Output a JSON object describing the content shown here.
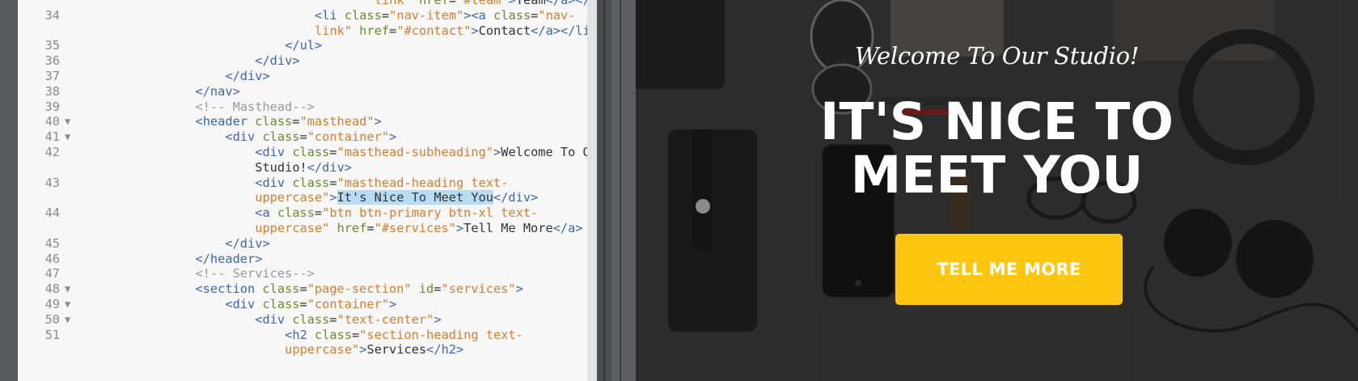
{
  "editor": {
    "lines": [
      {
        "num": "",
        "fold": false,
        "indent": 40,
        "tokens": [
          [
            "str",
            "link\" "
          ],
          [
            "attr",
            "href"
          ],
          [
            "txt",
            "="
          ],
          [
            "str",
            "\"#team\""
          ],
          [
            "tag",
            ">"
          ],
          [
            "txt",
            "Team"
          ],
          [
            "tag",
            "</a></li>"
          ]
        ]
      },
      {
        "num": "34",
        "fold": false,
        "indent": 32,
        "tokens": [
          [
            "tag",
            "<li "
          ],
          [
            "attr",
            "class"
          ],
          [
            "txt",
            "="
          ],
          [
            "str",
            "\"nav-item\""
          ],
          [
            "tag",
            "><a "
          ],
          [
            "attr",
            "class"
          ],
          [
            "txt",
            "="
          ],
          [
            "str",
            "\"nav-"
          ]
        ]
      },
      {
        "num": "",
        "fold": false,
        "indent": 32,
        "tokens": [
          [
            "str",
            "link\" "
          ],
          [
            "attr",
            "href"
          ],
          [
            "txt",
            "="
          ],
          [
            "str",
            "\"#contact\""
          ],
          [
            "tag",
            ">"
          ],
          [
            "txt",
            "Contact"
          ],
          [
            "tag",
            "</a></li>"
          ]
        ]
      },
      {
        "num": "35",
        "fold": false,
        "indent": 28,
        "tokens": [
          [
            "tag",
            "</ul>"
          ]
        ]
      },
      {
        "num": "36",
        "fold": false,
        "indent": 24,
        "tokens": [
          [
            "tag",
            "</div>"
          ]
        ]
      },
      {
        "num": "37",
        "fold": false,
        "indent": 20,
        "tokens": [
          [
            "tag",
            "</div>"
          ]
        ]
      },
      {
        "num": "38",
        "fold": false,
        "indent": 16,
        "tokens": [
          [
            "tag",
            "</nav>"
          ]
        ]
      },
      {
        "num": "39",
        "fold": false,
        "indent": 16,
        "tokens": [
          [
            "cm",
            "<!-- Masthead-->"
          ]
        ]
      },
      {
        "num": "40",
        "fold": true,
        "indent": 16,
        "tokens": [
          [
            "tag",
            "<header "
          ],
          [
            "attr",
            "class"
          ],
          [
            "txt",
            "="
          ],
          [
            "str",
            "\"masthead\""
          ],
          [
            "tag",
            ">"
          ]
        ]
      },
      {
        "num": "41",
        "fold": true,
        "indent": 20,
        "tokens": [
          [
            "tag",
            "<div "
          ],
          [
            "attr",
            "class"
          ],
          [
            "txt",
            "="
          ],
          [
            "str",
            "\"container\""
          ],
          [
            "tag",
            ">"
          ]
        ]
      },
      {
        "num": "42",
        "fold": false,
        "indent": 24,
        "tokens": [
          [
            "tag",
            "<div "
          ],
          [
            "attr",
            "class"
          ],
          [
            "txt",
            "="
          ],
          [
            "str",
            "\"masthead-subheading\""
          ],
          [
            "tag",
            ">"
          ],
          [
            "txt",
            "Welcome To Our"
          ]
        ]
      },
      {
        "num": "",
        "fold": false,
        "indent": 24,
        "tokens": [
          [
            "txt",
            "Studio!"
          ],
          [
            "tag",
            "</div>"
          ]
        ]
      },
      {
        "num": "43",
        "fold": false,
        "indent": 24,
        "tokens": [
          [
            "tag",
            "<div "
          ],
          [
            "attr",
            "class"
          ],
          [
            "txt",
            "="
          ],
          [
            "str",
            "\"masthead-heading text-"
          ]
        ]
      },
      {
        "num": "",
        "fold": false,
        "indent": 24,
        "tokens": [
          [
            "str",
            "uppercase\""
          ],
          [
            "tag",
            ">"
          ],
          [
            "sel",
            "It's Nice To Meet You"
          ],
          [
            "tag",
            "</div>"
          ]
        ]
      },
      {
        "num": "44",
        "fold": false,
        "indent": 24,
        "tokens": [
          [
            "tag",
            "<a "
          ],
          [
            "attr",
            "class"
          ],
          [
            "txt",
            "="
          ],
          [
            "str",
            "\"btn btn-primary btn-xl text-"
          ]
        ]
      },
      {
        "num": "",
        "fold": false,
        "indent": 24,
        "tokens": [
          [
            "str",
            "uppercase\" "
          ],
          [
            "attr",
            "href"
          ],
          [
            "txt",
            "="
          ],
          [
            "str",
            "\"#services\""
          ],
          [
            "tag",
            ">"
          ],
          [
            "txt",
            "Tell Me More"
          ],
          [
            "tag",
            "</a>"
          ]
        ]
      },
      {
        "num": "45",
        "fold": false,
        "indent": 20,
        "tokens": [
          [
            "tag",
            "</div>"
          ]
        ]
      },
      {
        "num": "46",
        "fold": false,
        "indent": 16,
        "tokens": [
          [
            "tag",
            "</header>"
          ]
        ]
      },
      {
        "num": "47",
        "fold": false,
        "indent": 16,
        "tokens": [
          [
            "cm",
            "<!-- Services-->"
          ]
        ]
      },
      {
        "num": "48",
        "fold": true,
        "indent": 16,
        "tokens": [
          [
            "tag",
            "<section "
          ],
          [
            "attr",
            "class"
          ],
          [
            "txt",
            "="
          ],
          [
            "str",
            "\"page-section\" "
          ],
          [
            "attr",
            "id"
          ],
          [
            "txt",
            "="
          ],
          [
            "str",
            "\"services\""
          ],
          [
            "tag",
            ">"
          ]
        ]
      },
      {
        "num": "49",
        "fold": true,
        "indent": 20,
        "tokens": [
          [
            "tag",
            "<div "
          ],
          [
            "attr",
            "class"
          ],
          [
            "txt",
            "="
          ],
          [
            "str",
            "\"container\""
          ],
          [
            "tag",
            ">"
          ]
        ]
      },
      {
        "num": "50",
        "fold": true,
        "indent": 24,
        "tokens": [
          [
            "tag",
            "<div "
          ],
          [
            "attr",
            "class"
          ],
          [
            "txt",
            "="
          ],
          [
            "str",
            "\"text-center\""
          ],
          [
            "tag",
            ">"
          ]
        ]
      },
      {
        "num": "51",
        "fold": false,
        "indent": 28,
        "tokens": [
          [
            "tag",
            "<h2 "
          ],
          [
            "attr",
            "class"
          ],
          [
            "txt",
            "="
          ],
          [
            "str",
            "\"section-heading text-"
          ]
        ]
      },
      {
        "num": "",
        "fold": false,
        "indent": 28,
        "tokens": [
          [
            "str",
            "uppercase\""
          ],
          [
            "tag",
            ">"
          ],
          [
            "txt",
            "Services"
          ],
          [
            "tag",
            "</h2>"
          ]
        ]
      }
    ],
    "fold_glyph": "▼",
    "colors": {
      "tag": "#3c65b4",
      "attr": "#6c8b2f",
      "string": "#d97c2b",
      "comment": "#9a9a9a",
      "selection": "#b8dcf3"
    }
  },
  "preview": {
    "subheading": "Welcome To Our Studio!",
    "heading": "IT'S NICE TO MEET YOU",
    "button_label": "TELL ME MORE",
    "colors": {
      "button": "#fec611",
      "text": "#ffffff"
    }
  }
}
